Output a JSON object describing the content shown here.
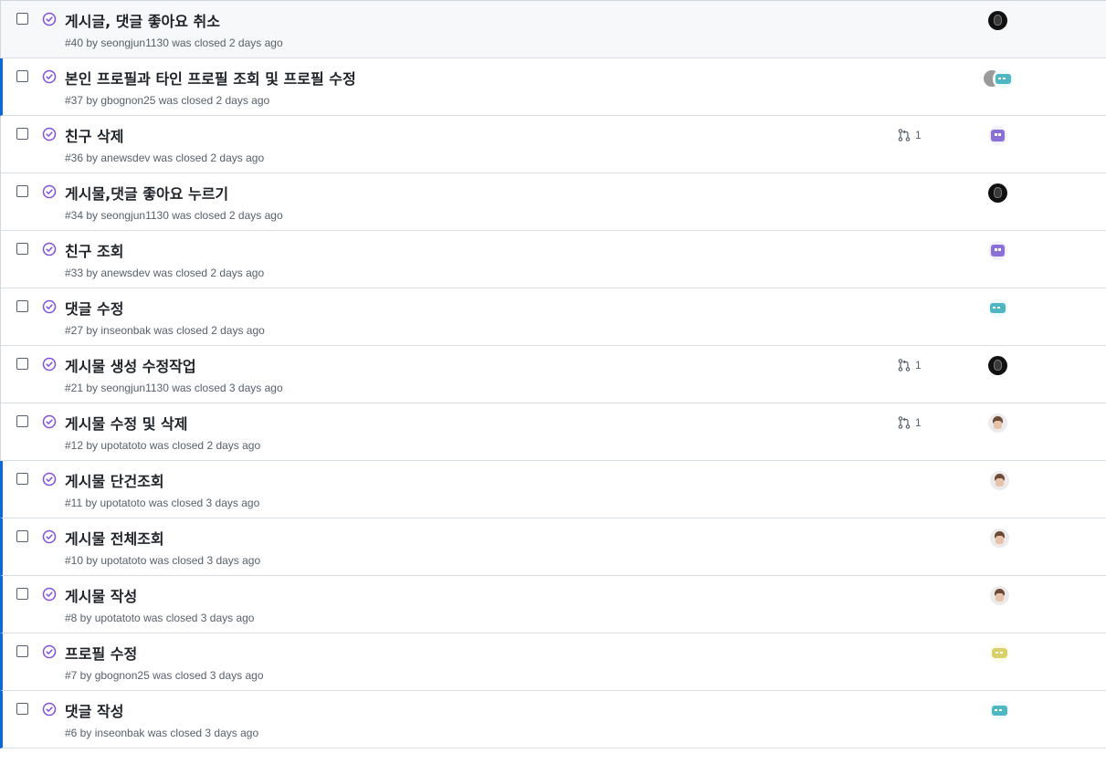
{
  "issues": [
    {
      "title": "게시글, 댓글 좋아요 취소",
      "meta": "#40 by seongjun1130 was closed 2 days ago",
      "linked_prs": "",
      "avatar": "dark"
    },
    {
      "title": "본인 프로필과 타인 프로필 조회 및 프로필 수정",
      "meta": "#37 by gbognon25 was closed 2 days ago",
      "linked_prs": "",
      "avatar": "stack-teal"
    },
    {
      "title": "친구 삭제",
      "meta": "#36 by anewsdev was closed 2 days ago",
      "linked_prs": "1",
      "avatar": "purple"
    },
    {
      "title": "게시물,댓글 좋아요 누르기",
      "meta": "#34 by seongjun1130 was closed 2 days ago",
      "linked_prs": "",
      "avatar": "dark"
    },
    {
      "title": "친구 조회",
      "meta": "#33 by anewsdev was closed 2 days ago",
      "linked_prs": "",
      "avatar": "purple"
    },
    {
      "title": "댓글 수정",
      "meta": "#27 by inseonbak was closed 2 days ago",
      "linked_prs": "",
      "avatar": "teal"
    },
    {
      "title": "게시물 생성 수정작업",
      "meta": "#21 by seongjun1130 was closed 3 days ago",
      "linked_prs": "1",
      "avatar": "dark"
    },
    {
      "title": "게시물 수정 및 삭제",
      "meta": "#12 by upotatoto was closed 2 days ago",
      "linked_prs": "1",
      "avatar": "person"
    },
    {
      "title": "게시물 단건조회",
      "meta": "#11 by upotatoto was closed 3 days ago",
      "linked_prs": "",
      "avatar": "person"
    },
    {
      "title": "게시물 전체조회",
      "meta": "#10 by upotatoto was closed 3 days ago",
      "linked_prs": "",
      "avatar": "person"
    },
    {
      "title": "게시물 작성",
      "meta": "#8 by upotatoto was closed 3 days ago",
      "linked_prs": "",
      "avatar": "person"
    },
    {
      "title": "프로필 수정",
      "meta": "#7 by gbognon25 was closed 3 days ago",
      "linked_prs": "",
      "avatar": "yellow"
    },
    {
      "title": "댓글 작성",
      "meta": "#6 by inseonbak was closed 3 days ago",
      "linked_prs": "",
      "avatar": "teal"
    }
  ],
  "colors": {
    "closed_icon": "#8250df",
    "accent": "#0969da",
    "muted": "#57606a"
  },
  "icons": {
    "state": "issue-closed-icon",
    "pr": "git-pull-request-icon"
  }
}
